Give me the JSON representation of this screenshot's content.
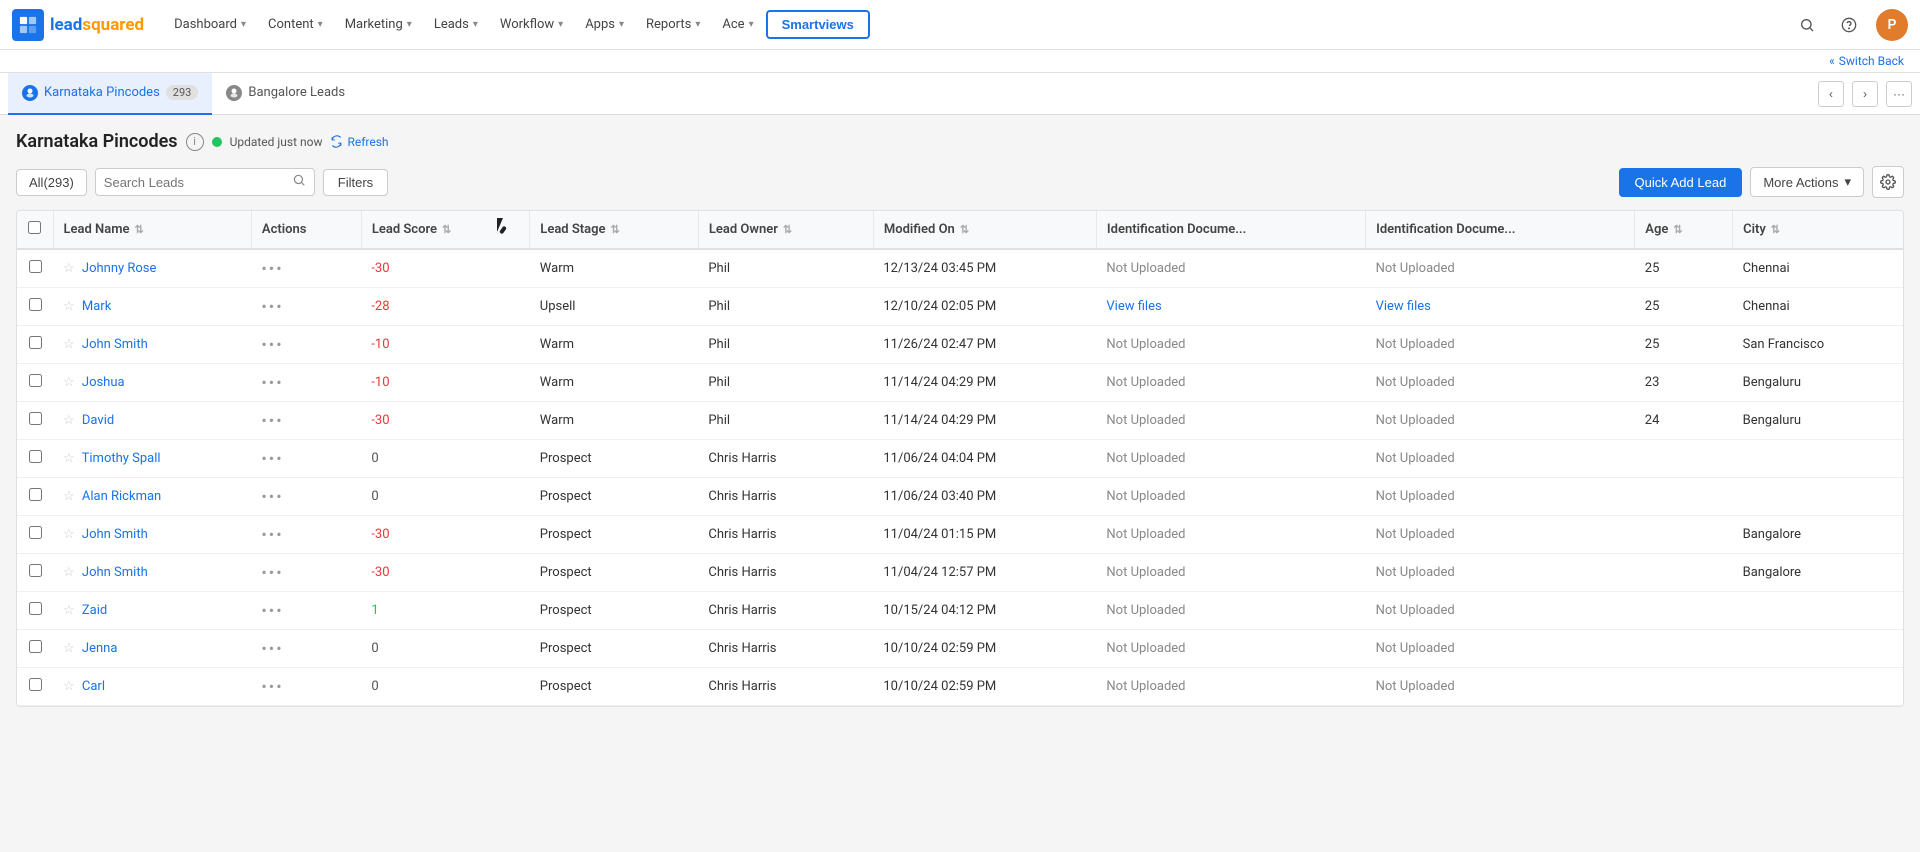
{
  "brand": {
    "name": "leadsquared",
    "logo_letter": "ls",
    "logo_color": "#1a73e8"
  },
  "topnav": {
    "items": [
      {
        "label": "Dashboard",
        "has_caret": true
      },
      {
        "label": "Content",
        "has_caret": true
      },
      {
        "label": "Marketing",
        "has_caret": true
      },
      {
        "label": "Leads",
        "has_caret": true
      },
      {
        "label": "Workflow",
        "has_caret": true
      },
      {
        "label": "Apps",
        "has_caret": true
      },
      {
        "label": "Reports",
        "has_caret": true
      },
      {
        "label": "Ace",
        "has_caret": true
      }
    ],
    "smartviews_label": "Smartviews",
    "user_initial": "P",
    "switch_back_label": "Switch Back"
  },
  "tabs": [
    {
      "id": "karnataka",
      "label": "Karnataka Pincodes",
      "badge": "293",
      "active": true
    },
    {
      "id": "bangalore",
      "label": "Bangalore Leads",
      "badge": "",
      "active": false
    }
  ],
  "page": {
    "title": "Karnataka Pincodes",
    "updated_text": "Updated just now",
    "refresh_label": "Refresh"
  },
  "toolbar": {
    "all_label": "All(293)",
    "search_placeholder": "Search Leads",
    "filters_label": "Filters",
    "quick_add_label": "Quick Add Lead",
    "more_actions_label": "More Actions",
    "settings_tooltip": "Settings"
  },
  "table": {
    "columns": [
      {
        "key": "lead_name",
        "label": "Lead Name",
        "sortable": true
      },
      {
        "key": "actions",
        "label": "Actions",
        "sortable": false
      },
      {
        "key": "lead_score",
        "label": "Lead Score",
        "sortable": true
      },
      {
        "key": "lead_stage",
        "label": "Lead Stage",
        "sortable": true
      },
      {
        "key": "lead_owner",
        "label": "Lead Owner",
        "sortable": true
      },
      {
        "key": "modified_on",
        "label": "Modified On",
        "sortable": true
      },
      {
        "key": "id_doc1",
        "label": "Identification Docume...",
        "sortable": false
      },
      {
        "key": "id_doc2",
        "label": "Identification Docume...",
        "sortable": false
      },
      {
        "key": "age",
        "label": "Age",
        "sortable": true
      },
      {
        "key": "city",
        "label": "City",
        "sortable": true
      }
    ],
    "rows": [
      {
        "name": "Johnny Rose",
        "score": "-30",
        "score_type": "negative",
        "stage": "Warm",
        "owner": "Phil",
        "modified": "12/13/24 03:45 PM",
        "id_doc1": "Not Uploaded",
        "id_doc2": "Not Uploaded",
        "id_doc1_link": false,
        "id_doc2_link": false,
        "age": "25",
        "city": "Chennai"
      },
      {
        "name": "Mark",
        "score": "-28",
        "score_type": "negative",
        "stage": "Upsell",
        "owner": "Phil",
        "modified": "12/10/24 02:05 PM",
        "id_doc1": "View files",
        "id_doc2": "View files",
        "id_doc1_link": true,
        "id_doc2_link": true,
        "age": "25",
        "city": "Chennai"
      },
      {
        "name": "John Smith",
        "score": "-10",
        "score_type": "negative",
        "stage": "Warm",
        "owner": "Phil",
        "modified": "11/26/24 02:47 PM",
        "id_doc1": "Not Uploaded",
        "id_doc2": "Not Uploaded",
        "id_doc1_link": false,
        "id_doc2_link": false,
        "age": "25",
        "city": "San Francisco"
      },
      {
        "name": "Joshua",
        "score": "-10",
        "score_type": "negative",
        "stage": "Warm",
        "owner": "Phil",
        "modified": "11/14/24 04:29 PM",
        "id_doc1": "Not Uploaded",
        "id_doc2": "Not Uploaded",
        "id_doc1_link": false,
        "id_doc2_link": false,
        "age": "23",
        "city": "Bengaluru"
      },
      {
        "name": "David",
        "score": "-30",
        "score_type": "negative",
        "stage": "Warm",
        "owner": "Phil",
        "modified": "11/14/24 04:29 PM",
        "id_doc1": "Not Uploaded",
        "id_doc2": "Not Uploaded",
        "id_doc1_link": false,
        "id_doc2_link": false,
        "age": "24",
        "city": "Bengaluru"
      },
      {
        "name": "Timothy Spall",
        "score": "0",
        "score_type": "zero",
        "stage": "Prospect",
        "owner": "Chris Harris",
        "modified": "11/06/24 04:04 PM",
        "id_doc1": "Not Uploaded",
        "id_doc2": "Not Uploaded",
        "id_doc1_link": false,
        "id_doc2_link": false,
        "age": "",
        "city": ""
      },
      {
        "name": "Alan Rickman",
        "score": "0",
        "score_type": "zero",
        "stage": "Prospect",
        "owner": "Chris Harris",
        "modified": "11/06/24 03:40 PM",
        "id_doc1": "Not Uploaded",
        "id_doc2": "Not Uploaded",
        "id_doc1_link": false,
        "id_doc2_link": false,
        "age": "",
        "city": ""
      },
      {
        "name": "John Smith",
        "score": "-30",
        "score_type": "negative",
        "stage": "Prospect",
        "owner": "Chris Harris",
        "modified": "11/04/24 01:15 PM",
        "id_doc1": "Not Uploaded",
        "id_doc2": "Not Uploaded",
        "id_doc1_link": false,
        "id_doc2_link": false,
        "age": "",
        "city": "Bangalore"
      },
      {
        "name": "John Smith",
        "score": "-30",
        "score_type": "negative",
        "stage": "Prospect",
        "owner": "Chris Harris",
        "modified": "11/04/24 12:57 PM",
        "id_doc1": "Not Uploaded",
        "id_doc2": "Not Uploaded",
        "id_doc1_link": false,
        "id_doc2_link": false,
        "age": "",
        "city": "Bangalore"
      },
      {
        "name": "Zaid",
        "score": "1",
        "score_type": "positive",
        "stage": "Prospect",
        "owner": "Chris Harris",
        "modified": "10/15/24 04:12 PM",
        "id_doc1": "Not Uploaded",
        "id_doc2": "Not Uploaded",
        "id_doc1_link": false,
        "id_doc2_link": false,
        "age": "",
        "city": ""
      },
      {
        "name": "Jenna",
        "score": "0",
        "score_type": "zero",
        "stage": "Prospect",
        "owner": "Chris Harris",
        "modified": "10/10/24 02:59 PM",
        "id_doc1": "Not Uploaded",
        "id_doc2": "Not Uploaded",
        "id_doc1_link": false,
        "id_doc2_link": false,
        "age": "",
        "city": ""
      },
      {
        "name": "Carl",
        "score": "0",
        "score_type": "zero",
        "stage": "Prospect",
        "owner": "Chris Harris",
        "modified": "10/10/24 02:59 PM",
        "id_doc1": "Not Uploaded",
        "id_doc2": "Not Uploaded",
        "id_doc1_link": false,
        "id_doc2_link": false,
        "age": "",
        "city": ""
      }
    ]
  }
}
